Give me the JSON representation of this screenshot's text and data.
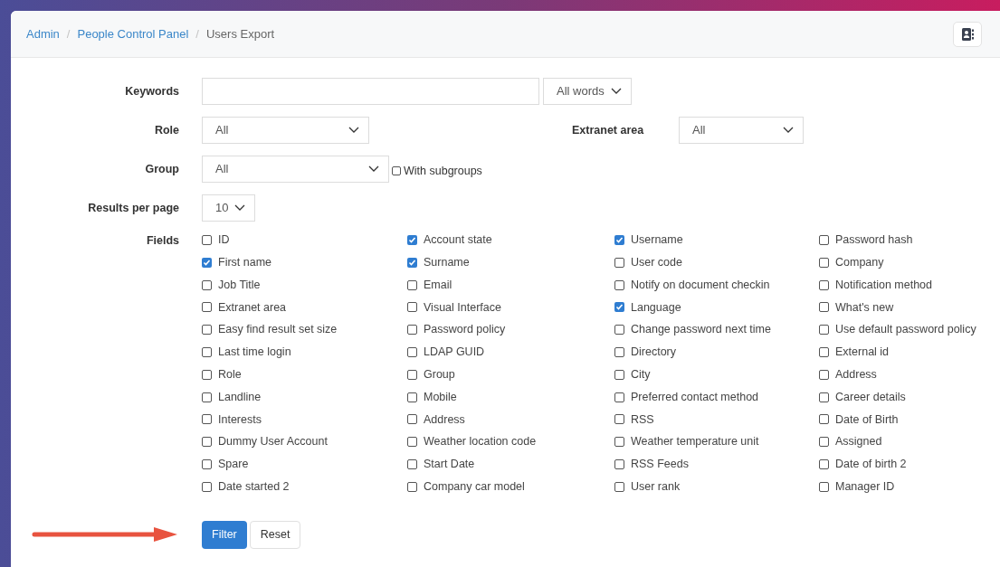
{
  "breadcrumb_separator": "/",
  "breadcrumb": [
    {
      "label": "Admin",
      "link": true
    },
    {
      "label": "People Control Panel",
      "link": true
    },
    {
      "label": "Users Export",
      "link": false
    }
  ],
  "form": {
    "keywords": {
      "label": "Keywords",
      "match": "All words"
    },
    "role": {
      "label": "Role",
      "value": "All"
    },
    "extranet_area": {
      "label": "Extranet area",
      "value": "All"
    },
    "group": {
      "label": "Group",
      "value": "All",
      "subgroups_label": "With subgroups",
      "subgroups_checked": false
    },
    "results_per_page": {
      "label": "Results per page",
      "value": "10"
    },
    "fields_label": "Fields",
    "fields": [
      {
        "label": "ID",
        "checked": false
      },
      {
        "label": "Account state",
        "checked": true
      },
      {
        "label": "Username",
        "checked": true
      },
      {
        "label": "Password hash",
        "checked": false
      },
      {
        "label": "First name",
        "checked": true
      },
      {
        "label": "Surname",
        "checked": true
      },
      {
        "label": "User code",
        "checked": false
      },
      {
        "label": "Company",
        "checked": false
      },
      {
        "label": "Job Title",
        "checked": false
      },
      {
        "label": "Email",
        "checked": false
      },
      {
        "label": "Notify on document checkin",
        "checked": false
      },
      {
        "label": "Notification method",
        "checked": false
      },
      {
        "label": "Extranet area",
        "checked": false
      },
      {
        "label": "Visual Interface",
        "checked": false
      },
      {
        "label": "Language",
        "checked": true
      },
      {
        "label": "What's new",
        "checked": false
      },
      {
        "label": "Easy find result set size",
        "checked": false
      },
      {
        "label": "Password policy",
        "checked": false
      },
      {
        "label": "Change password next time",
        "checked": false
      },
      {
        "label": "Use default password policy",
        "checked": false
      },
      {
        "label": "Last time login",
        "checked": false
      },
      {
        "label": "LDAP GUID",
        "checked": false
      },
      {
        "label": "Directory",
        "checked": false
      },
      {
        "label": "External id",
        "checked": false
      },
      {
        "label": "Role",
        "checked": false
      },
      {
        "label": "Group",
        "checked": false
      },
      {
        "label": "City",
        "checked": false
      },
      {
        "label": "Address",
        "checked": false
      },
      {
        "label": "Landline",
        "checked": false
      },
      {
        "label": "Mobile",
        "checked": false
      },
      {
        "label": "Preferred contact method",
        "checked": false
      },
      {
        "label": "Career details",
        "checked": false
      },
      {
        "label": "Interests",
        "checked": false
      },
      {
        "label": "Address",
        "checked": false
      },
      {
        "label": "RSS",
        "checked": false
      },
      {
        "label": "Date of Birth",
        "checked": false
      },
      {
        "label": "Dummy User Account",
        "checked": false
      },
      {
        "label": "Weather location code",
        "checked": false
      },
      {
        "label": "Weather temperature unit",
        "checked": false
      },
      {
        "label": "Assigned",
        "checked": false
      },
      {
        "label": "Spare",
        "checked": false
      },
      {
        "label": "Start Date",
        "checked": false
      },
      {
        "label": "RSS Feeds",
        "checked": false
      },
      {
        "label": "Date of birth 2",
        "checked": false
      },
      {
        "label": "Date started 2",
        "checked": false
      },
      {
        "label": "Company car model",
        "checked": false
      },
      {
        "label": "User rank",
        "checked": false
      },
      {
        "label": "Manager ID",
        "checked": false
      }
    ]
  },
  "buttons": [
    {
      "label": "Filter",
      "kind": "primary"
    },
    {
      "label": "Reset",
      "kind": "secondary"
    }
  ]
}
